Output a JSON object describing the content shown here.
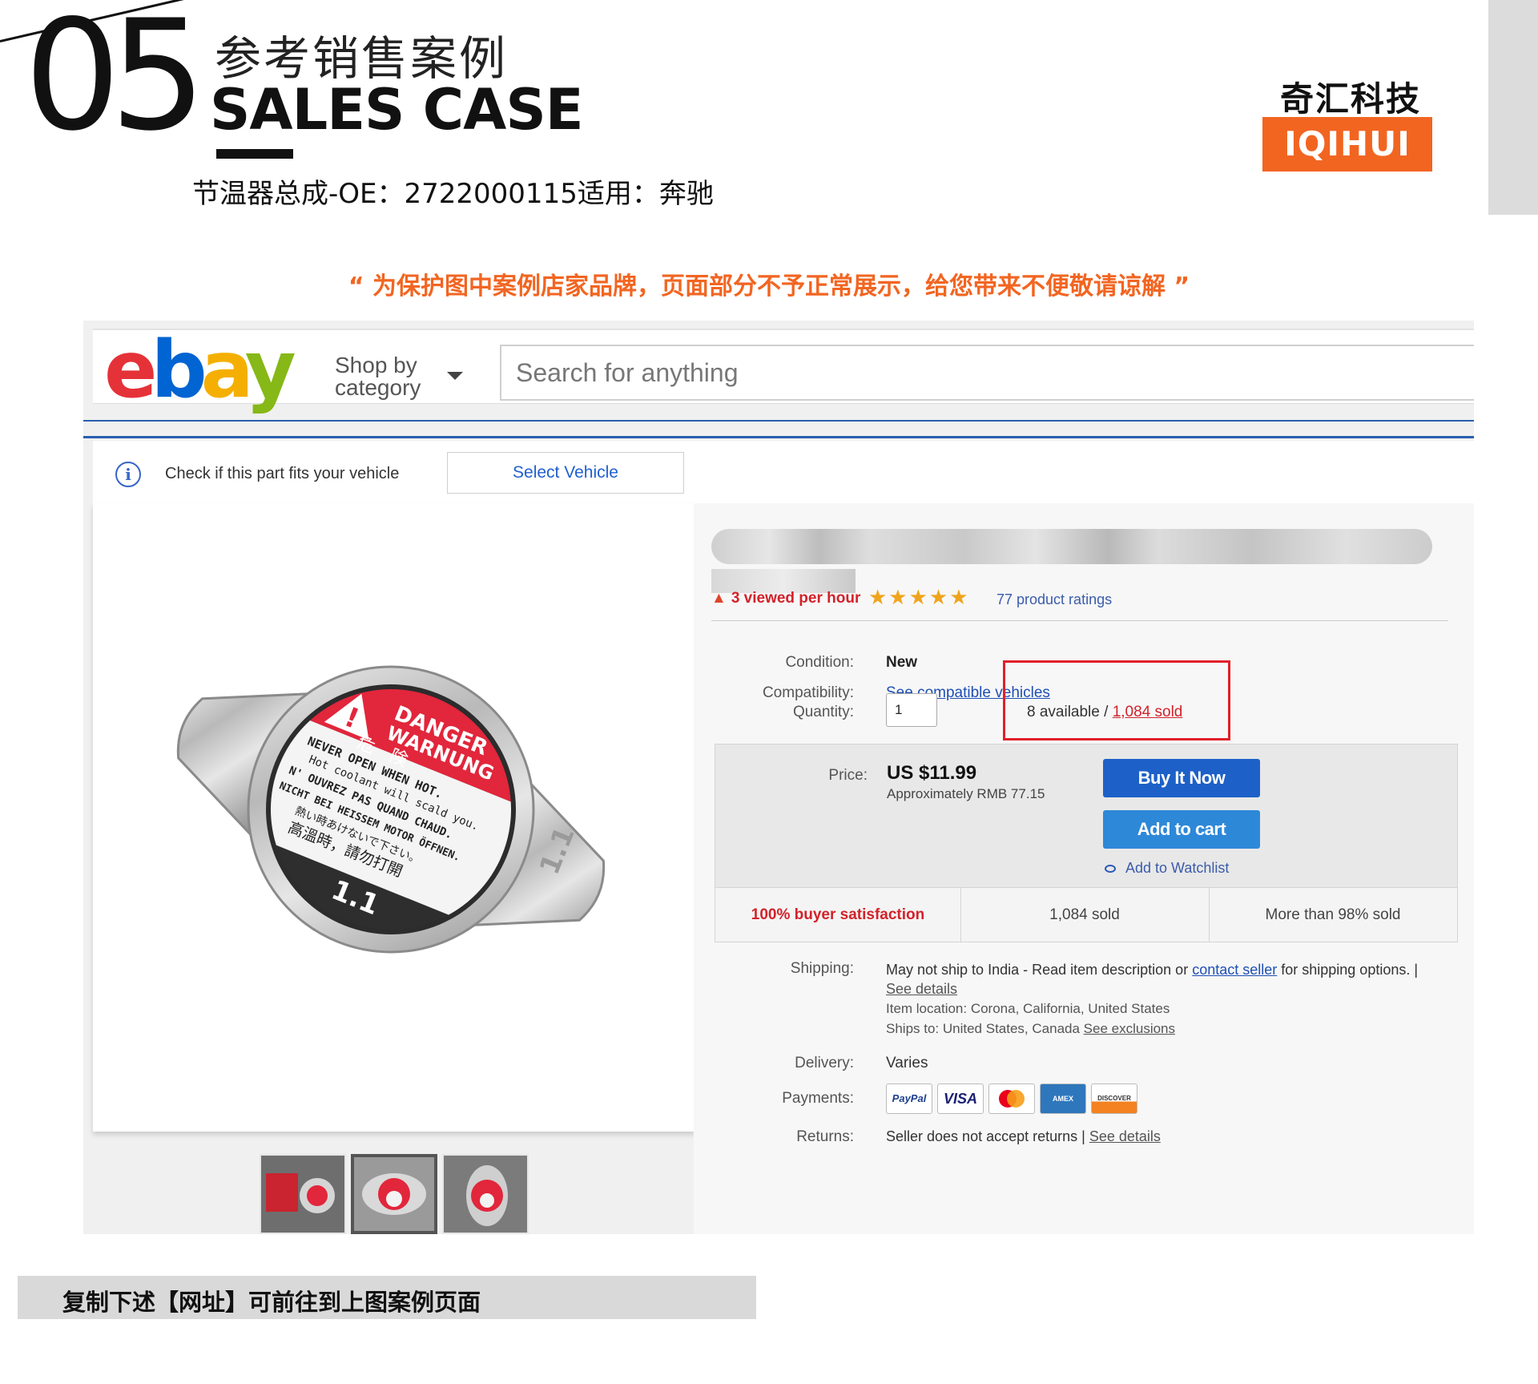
{
  "header": {
    "number": "05",
    "title_cn": "参考销售案例",
    "title_en": "SALES CASE",
    "subtitle": "节温器总成-OE：2722000115适用：奔驰"
  },
  "brand": {
    "name_cn": "奇汇科技",
    "name_en": "IQIHUI",
    "accent_color": "#f26521"
  },
  "notice": "“ 为保护图中案例店家品牌，页面部分不予正常展示，给您带来不便敬请谅解 ”",
  "ebay": {
    "logo": {
      "e": "e",
      "b": "b",
      "a": "a",
      "y": "y"
    },
    "shop_by_category": {
      "line1": "Shop by",
      "line2": "category"
    },
    "search_placeholder": "Search for anything",
    "fitment": {
      "text": "Check if this part fits your vehicle",
      "button": "Select Vehicle"
    },
    "listing": {
      "title_partial": "C... ...e",
      "viewed": "3 viewed per hour",
      "stars": "★★★★★",
      "ratings": "77 product ratings",
      "condition_label": "Condition:",
      "condition": "New",
      "compatibility_label": "Compatibility:",
      "compatibility_link": "See compatible vehicles",
      "quantity_label": "Quantity:",
      "quantity_value": "1",
      "available": "8 available / ",
      "sold_link": "1,084 sold",
      "price_label": "Price:",
      "price": "US $11.99",
      "approx": "Approximately RMB 77.15",
      "buy_now": "Buy It Now",
      "add_to_cart": "Add to cart",
      "watchlist": "Add to Watchlist",
      "stats": [
        "100% buyer satisfaction",
        "1,084 sold",
        "More than 98% sold"
      ],
      "shipping_label": "Shipping:",
      "shipping_pre": "May not ship to India - Read item description or ",
      "shipping_link": "contact seller",
      "shipping_post": " for shipping options. | ",
      "see_details": "See details",
      "item_location": "Item location: Corona, California, United States",
      "ships_to": "Ships to: United States, Canada ",
      "see_exclusions": "See exclusions",
      "delivery_label": "Delivery:",
      "delivery": "Varies",
      "payments_label": "Payments:",
      "payments": [
        "PayPal",
        "VISA",
        "MC",
        "AMEX",
        "DISCOVER"
      ],
      "returns_label": "Returns:",
      "returns": "Seller does not accept returns | ",
      "returns_link": "See details"
    },
    "product_cap": {
      "danger": "DANGER",
      "warnung": "WARNUNG",
      "kiken": "危　険",
      "lines": [
        "NEVER OPEN WHEN HOT.",
        "Hot coolant will scald you.",
        "N' OUVREZ PAS QUAND CHAUD.",
        "NICHT BEI HEISSEM MOTOR ÖFFNEN.",
        "熱い時あけないで下さい。",
        "高溫時，請勿打開"
      ],
      "pressure": "1.1"
    }
  },
  "footer": "复制下述【网址】可前往到上图案例页面"
}
